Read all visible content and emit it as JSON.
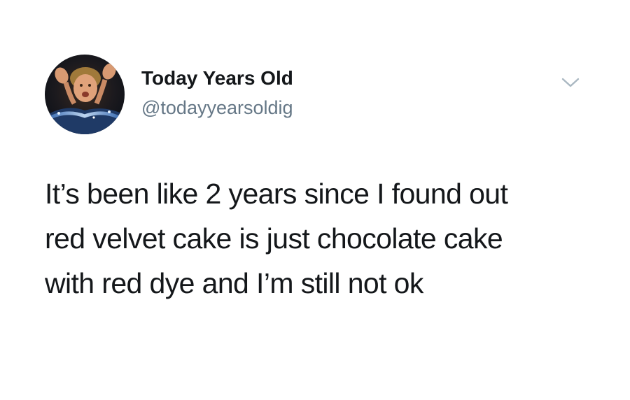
{
  "author": {
    "display_name": "Today Years Old",
    "handle": "@todayyearsoldig",
    "avatar_icon": "avatar-photo"
  },
  "menu": {
    "icon": "chevron-down-icon",
    "color": "#aab8c2"
  },
  "tweet": {
    "lines": [
      "It’s been like 2 years since I found out",
      "red velvet cake is just chocolate cake",
      "with red dye and I’m still not ok"
    ]
  },
  "colors": {
    "background": "#ffffff",
    "text_primary": "#14171a",
    "text_secondary": "#657786"
  }
}
